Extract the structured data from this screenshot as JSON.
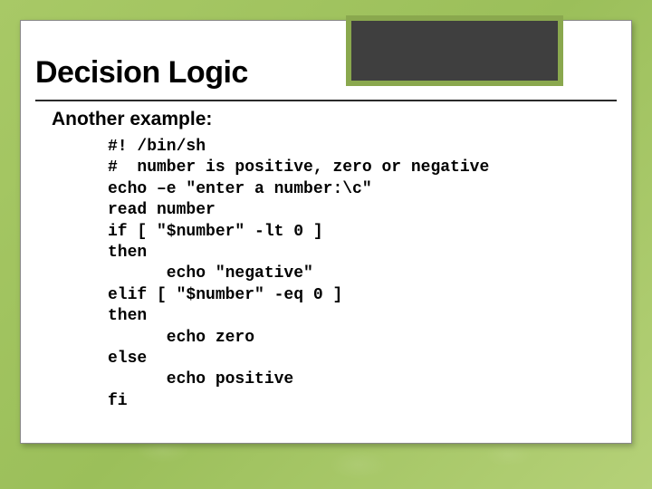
{
  "slide": {
    "title": "Decision Logic",
    "subtitle": "Another example:",
    "code": "#! /bin/sh\n#  number is positive, zero or negative\necho –e \"enter a number:\\c\"\nread number\nif [ \"$number\" -lt 0 ]\nthen\n      echo \"negative\"\nelif [ \"$number\" -eq 0 ]\nthen\n      echo zero\nelse\n      echo positive\nfi"
  }
}
